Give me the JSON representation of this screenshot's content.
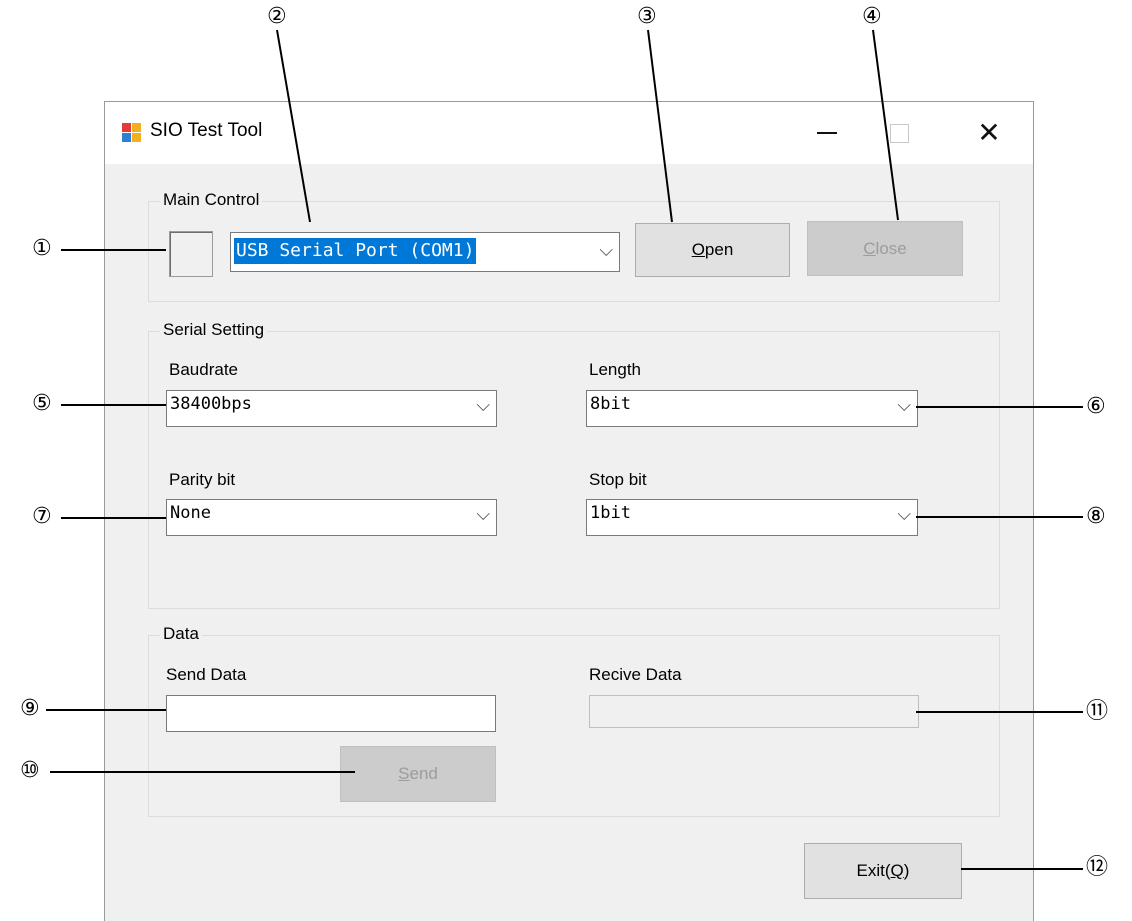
{
  "window": {
    "title": "SIO Test Tool"
  },
  "main_control": {
    "group_label": "Main Control",
    "port_value": "USB Serial Port (COM1)",
    "open_label": "Open",
    "close_label": "Close"
  },
  "serial_setting": {
    "group_label": "Serial Setting",
    "baudrate_label": "Baudrate",
    "baudrate_value": "38400bps",
    "length_label": "Length",
    "length_value": "8bit",
    "parity_label": "Parity bit",
    "parity_value": "None",
    "stop_label": "Stop bit",
    "stop_value": "1bit"
  },
  "data": {
    "group_label": "Data",
    "send_label": "Send Data",
    "send_value": "",
    "receive_label": "Recive Data",
    "receive_value": "",
    "send_button": "Send"
  },
  "exit_label": "Exit(Q)",
  "callouts": [
    "①",
    "②",
    "③",
    "④",
    "⑤",
    "⑥",
    "⑦",
    "⑧",
    "⑨",
    "⑩",
    "⑪",
    "⑫"
  ],
  "colors": {
    "selection": "#0078d7",
    "window_bg": "#f0f0f0",
    "disabled_button": "#cccccc"
  }
}
